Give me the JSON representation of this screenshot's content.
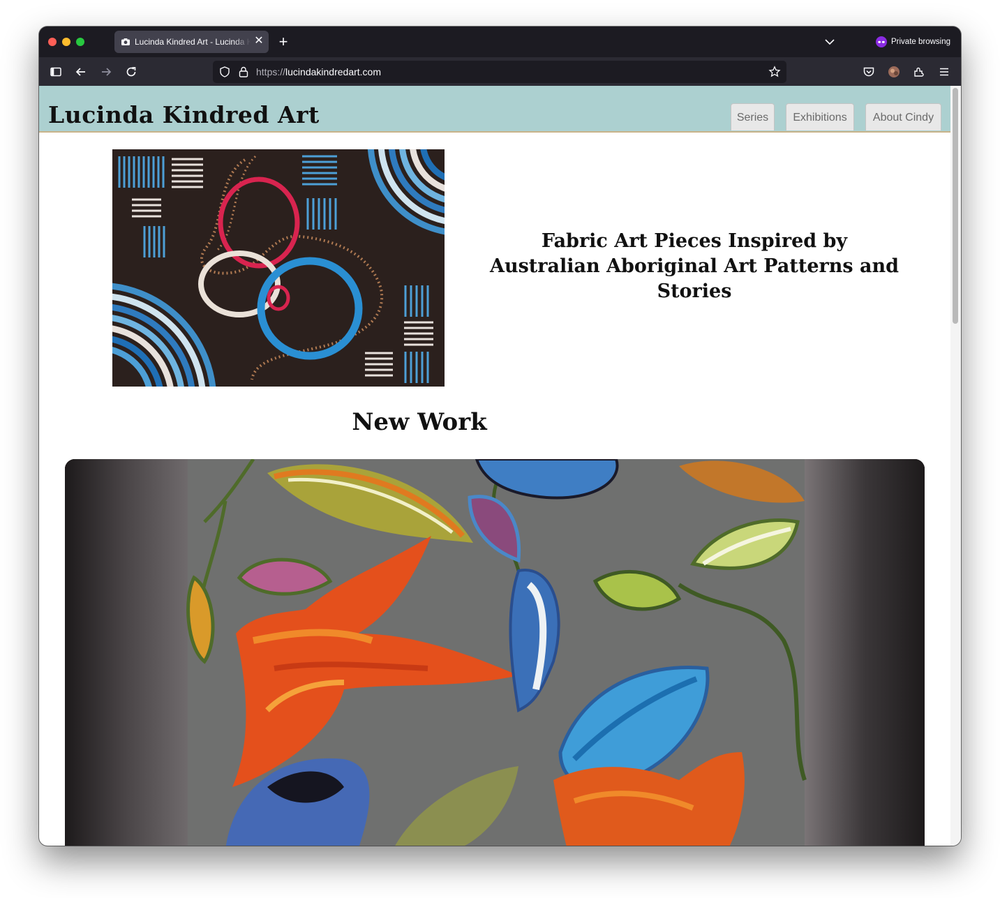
{
  "browser": {
    "tab_title": "Lucinda Kindred Art - Lucinda Kindred Art",
    "tab_close": "✕",
    "new_tab": "+",
    "private_label": "Private browsing",
    "url_scheme": "https://",
    "url_host": "lucindakindredart.com"
  },
  "site": {
    "title": "Lucinda Kindred Art",
    "nav": [
      "Series",
      "Exhibitions",
      "About Cindy"
    ],
    "hero_heading": "Fabric Art Pieces Inspired by Australian Aboriginal Art Patterns and Stories",
    "new_work_heading": "New Work"
  },
  "icons": [
    "sidebar-icon",
    "back-icon",
    "forward-icon",
    "reload-icon",
    "shield-icon",
    "lock-icon",
    "bookmark-star-icon",
    "pocket-icon",
    "account-avatar-icon",
    "extensions-icon",
    "menu-icon",
    "tab-list-chevron-icon",
    "private-mask-icon"
  ],
  "colors": {
    "header_bg": "#acd0d0",
    "chrome_dark": "#1c1b22",
    "navbar": "#2b2a33"
  }
}
